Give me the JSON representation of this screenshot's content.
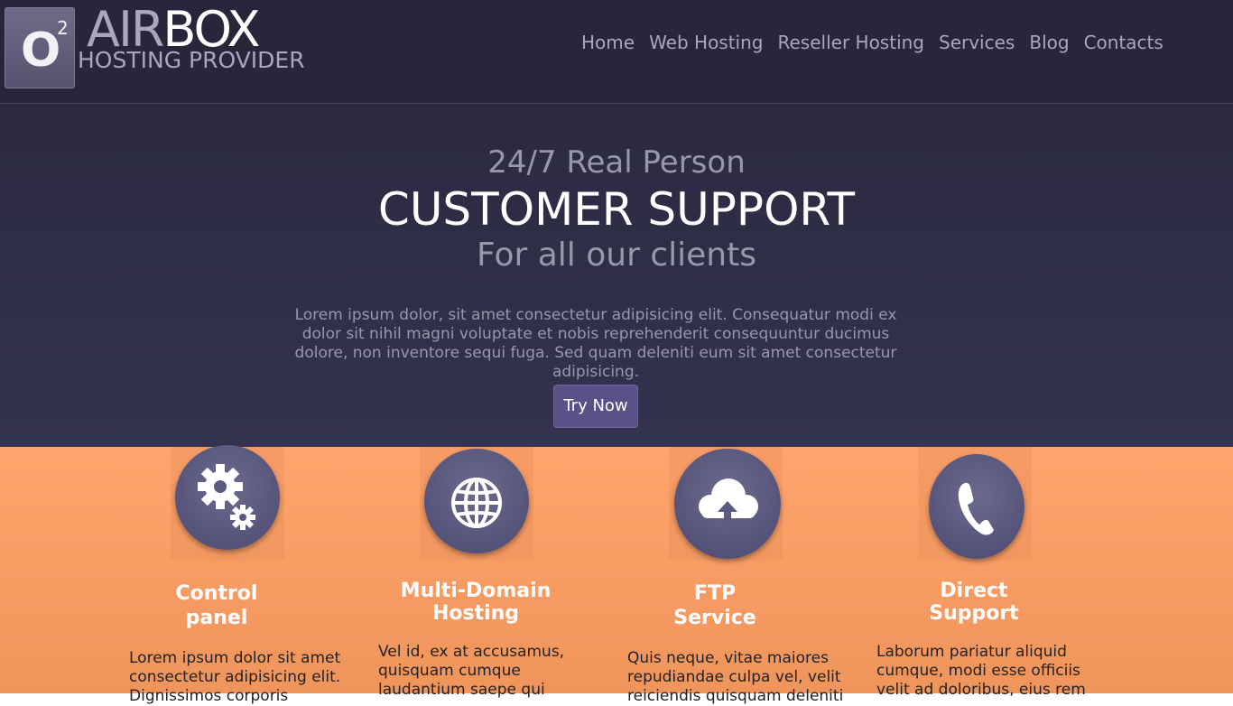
{
  "header": {
    "logo_letter": "O",
    "logo_sup": "2",
    "brand_air": "AIR",
    "brand_box": "BOX",
    "tagline": "HOSTING PROVIDER",
    "nav": [
      "Home",
      "Web Hosting",
      "Reseller Hosting",
      "Services",
      "Blog",
      "Contacts"
    ]
  },
  "hero": {
    "line1": "24/7 Real Person",
    "line2": "CUSTOMER SUPPORT",
    "line3": "For all our clients",
    "description": "Lorem ipsum dolor, sit amet consectetur adipisicing elit. Consequatur modi ex dolor sit nihil magni voluptate et nobis reprehenderit consequuntur ducimus dolore, non inventore sequi fuga. Sed quam deleniti eum sit amet consectetur adipisicing.",
    "cta_label": "Try Now"
  },
  "features": [
    {
      "icon": "gears-icon",
      "title_1": "Control",
      "title_2": "panel",
      "text": "Lorem ipsum dolor sit amet consectetur adipisicing elit. Dignissimos corporis"
    },
    {
      "icon": "globe-icon",
      "title_1": "Multi-Domain",
      "title_2": "Hosting",
      "text": "Vel id, ex at accusamus, quisquam cumque laudantium saepe qui"
    },
    {
      "icon": "cloud-upload-icon",
      "title_1": "FTP",
      "title_2": "Service",
      "text": "Quis neque, vitae maiores repudiandae culpa vel, velit reiciendis quisquam deleniti"
    },
    {
      "icon": "phone-icon",
      "title_1": "Direct",
      "title_2": "Support",
      "text": "Laborum pariatur aliquid cumque, modi esse officiis velit ad doloribus, eius rem"
    }
  ],
  "colors": {
    "header_bg": "#28263a",
    "hero_bg": "#2f2e48",
    "accent_button": "#5a5286",
    "features_bg": "#ffa46c",
    "icon_circle": "#5c5a80"
  }
}
